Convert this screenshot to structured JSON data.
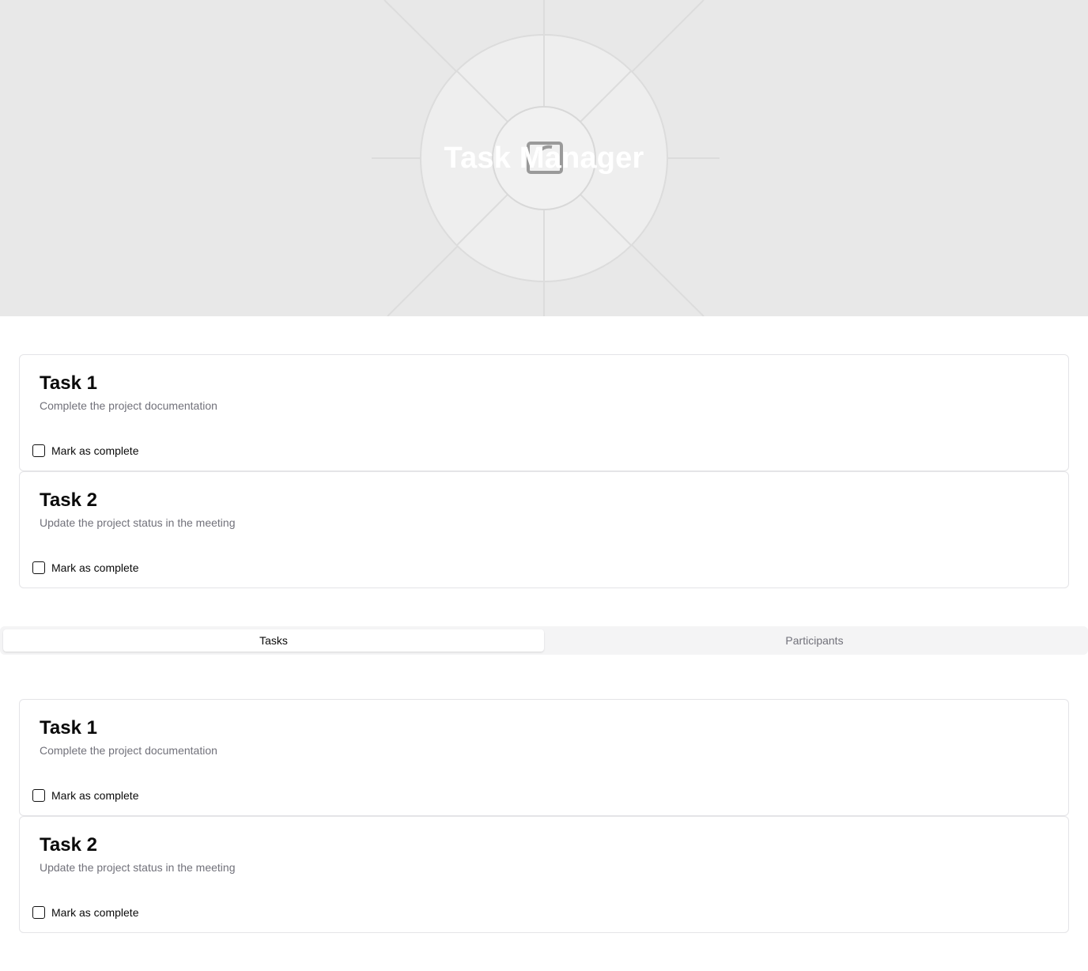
{
  "hero": {
    "title": "Task Manager",
    "icon": "check-square-icon",
    "background_color": "#e8e8e8"
  },
  "tasks_top": [
    {
      "title": "Task 1",
      "description": "Complete the project documentation",
      "complete_label": "Mark as complete",
      "completed": false
    },
    {
      "title": "Task 2",
      "description": "Update the project status in the meeting",
      "complete_label": "Mark as complete",
      "completed": false
    }
  ],
  "tabs": [
    {
      "label": "Tasks",
      "active": true
    },
    {
      "label": "Participants",
      "active": false
    }
  ],
  "tasks_bottom": [
    {
      "title": "Task 1",
      "description": "Complete the project documentation",
      "complete_label": "Mark as complete",
      "completed": false
    },
    {
      "title": "Task 2",
      "description": "Update the project status in the meeting",
      "complete_label": "Mark as complete",
      "completed": false
    }
  ],
  "colors": {
    "muted_text": "#71717a",
    "border": "#e4e4e7",
    "tab_bg": "#f4f4f5"
  }
}
